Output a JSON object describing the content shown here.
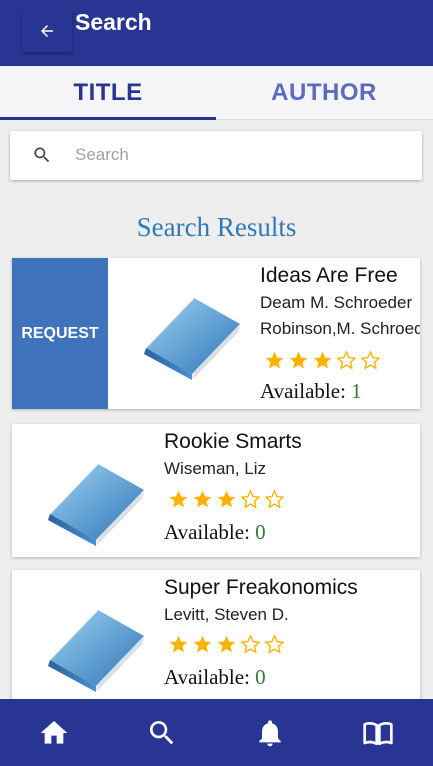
{
  "header": {
    "title": "Search",
    "back_icon": "arrow-left-icon"
  },
  "tabs": [
    {
      "label": "TITLE",
      "active": true
    },
    {
      "label": "AUTHOR",
      "active": false
    }
  ],
  "search": {
    "placeholder": "Search",
    "value": ""
  },
  "results": {
    "heading": "Search Results",
    "available_label": "Available:",
    "items": [
      {
        "title": "Ideas Are Free",
        "authors": [
          "Deam M. Schroeder",
          "Robinson,M. Schroeder"
        ],
        "rating": 3,
        "rating_max": 5,
        "available": "1",
        "request_label": "REQUEST"
      },
      {
        "title": "Rookie Smarts",
        "authors": [
          "Wiseman, Liz"
        ],
        "rating": 3,
        "rating_max": 5,
        "available": "0"
      },
      {
        "title": "Super Freakonomics",
        "authors": [
          "Levitt, Steven D."
        ],
        "rating": 3,
        "rating_max": 5,
        "available": "0"
      }
    ]
  },
  "bottom_nav": [
    {
      "icon": "home-icon",
      "label": "Home"
    },
    {
      "icon": "search-icon",
      "label": "Search"
    },
    {
      "icon": "bell-icon",
      "label": "Notifications"
    },
    {
      "icon": "book-open-icon",
      "label": "Library"
    }
  ],
  "colors": {
    "primary": "#283593",
    "accent_blue": "#3f73bb",
    "heading_blue": "#2e7ab8",
    "star": "#ffb300",
    "available_green": "#2e7d32"
  }
}
